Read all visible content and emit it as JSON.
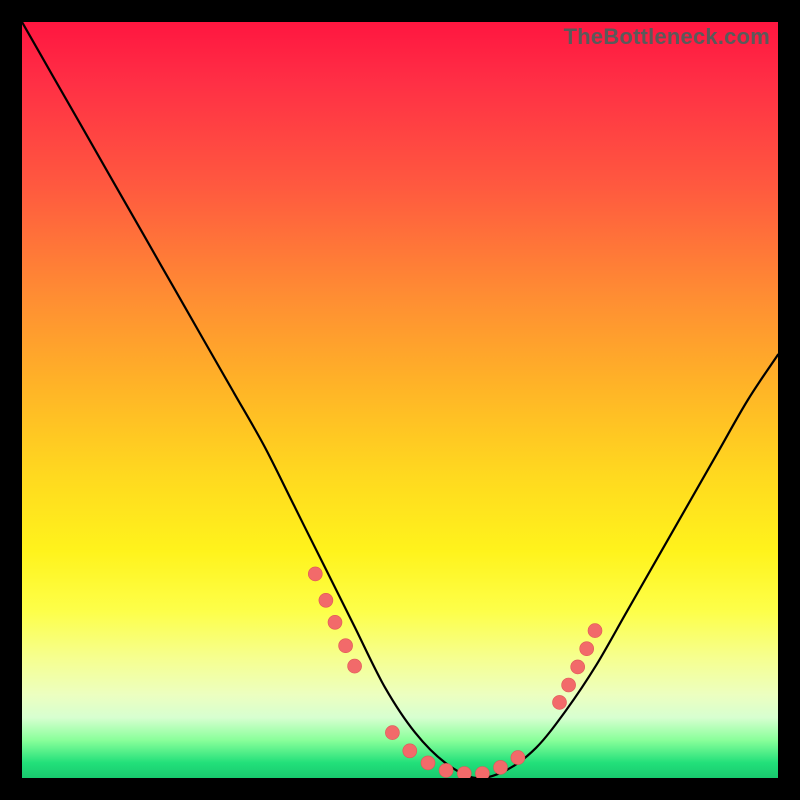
{
  "watermark": "TheBottleneck.com",
  "colors": {
    "page_bg": "#000000",
    "curve": "#000000",
    "dot_fill": "#f26a6a",
    "dot_stroke": "#e05656"
  },
  "chart_data": {
    "type": "line",
    "title": "",
    "xlabel": "",
    "ylabel": "",
    "xlim": [
      0,
      100
    ],
    "ylim": [
      0,
      100
    ],
    "note": "Axis values are normalized 0–100 in each direction; the original image has no tick labels.",
    "series": [
      {
        "name": "bottleneck-curve",
        "x": [
          0,
          4,
          8,
          12,
          16,
          20,
          24,
          28,
          32,
          36,
          40,
          44,
          48,
          52,
          56,
          60,
          64,
          68,
          72,
          76,
          80,
          84,
          88,
          92,
          96,
          100
        ],
        "y": [
          100,
          93,
          86,
          79,
          72,
          65,
          58,
          51,
          44,
          36,
          28,
          20,
          12,
          6,
          2,
          0,
          1,
          4,
          9,
          15,
          22,
          29,
          36,
          43,
          50,
          56
        ]
      }
    ],
    "markers": [
      {
        "x": 38.8,
        "y": 27.0
      },
      {
        "x": 40.2,
        "y": 23.5
      },
      {
        "x": 41.4,
        "y": 20.6
      },
      {
        "x": 42.8,
        "y": 17.5
      },
      {
        "x": 44.0,
        "y": 14.8
      },
      {
        "x": 49.0,
        "y": 6.0
      },
      {
        "x": 51.3,
        "y": 3.6
      },
      {
        "x": 53.7,
        "y": 2.0
      },
      {
        "x": 56.1,
        "y": 1.0
      },
      {
        "x": 58.5,
        "y": 0.6
      },
      {
        "x": 60.9,
        "y": 0.6
      },
      {
        "x": 63.3,
        "y": 1.4
      },
      {
        "x": 65.6,
        "y": 2.7
      },
      {
        "x": 71.1,
        "y": 10.0
      },
      {
        "x": 72.3,
        "y": 12.3
      },
      {
        "x": 73.5,
        "y": 14.7
      },
      {
        "x": 74.7,
        "y": 17.1
      },
      {
        "x": 75.8,
        "y": 19.5
      }
    ]
  }
}
